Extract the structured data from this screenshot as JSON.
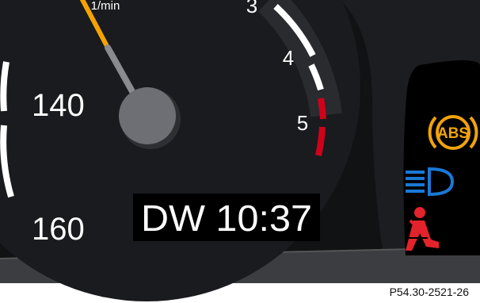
{
  "speedometer": {
    "labels": [
      "140",
      "160"
    ]
  },
  "tachometer": {
    "unit": "1/min",
    "labels": [
      "3",
      "4",
      "5"
    ],
    "redline_color": "#d0021b"
  },
  "display": {
    "text": "DW 10:37"
  },
  "warning_lamps": [
    {
      "icon": "abs-warning-icon",
      "text": "ABS",
      "color": "#f0a30a"
    },
    {
      "icon": "high-beam-icon",
      "color": "#1a78d6"
    },
    {
      "icon": "seat-belt-warning-icon",
      "color": "#e3232b"
    }
  ],
  "caption": "P54.30-2521-26"
}
